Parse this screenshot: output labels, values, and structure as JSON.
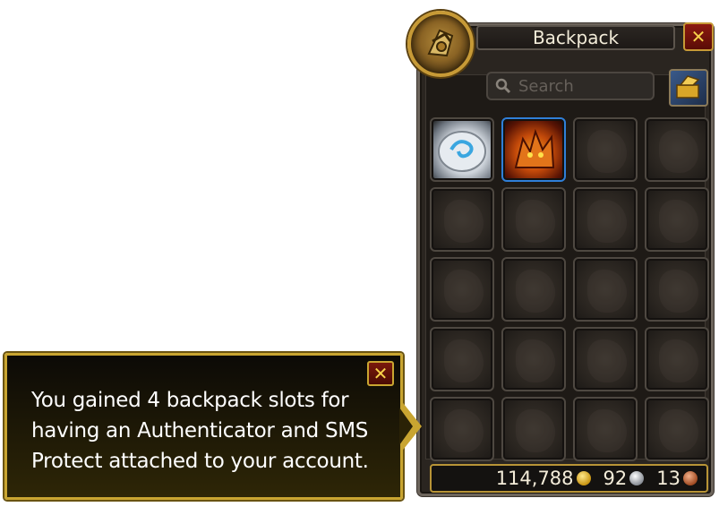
{
  "backpack": {
    "title": "Backpack",
    "search_placeholder": "Search",
    "slots": [
      {
        "item": "hearthstone"
      },
      {
        "item": "fire-pet"
      },
      {
        "item": null
      },
      {
        "item": null
      },
      {
        "item": null
      },
      {
        "item": null
      },
      {
        "item": null
      },
      {
        "item": null
      },
      {
        "item": null
      },
      {
        "item": null
      },
      {
        "item": null
      },
      {
        "item": null
      },
      {
        "item": null
      },
      {
        "item": null
      },
      {
        "item": null
      },
      {
        "item": null
      },
      {
        "item": null
      },
      {
        "item": null
      },
      {
        "item": null
      },
      {
        "item": null
      }
    ],
    "money": {
      "gold": "114,788",
      "silver": "92",
      "copper": "13"
    },
    "icons": {
      "portrait": "backpack-portrait-icon",
      "close": "close-icon",
      "search": "search-icon",
      "sort": "cleanup-bags-icon"
    }
  },
  "tooltip": {
    "line1": "You gained 4 backpack slots for",
    "line2": "having an Authenticator and SMS",
    "line3": "Protect attached to your account."
  },
  "colors": {
    "frame": "#2a2520",
    "gold_border": "#c9a531",
    "title_text": "#f3ecd9",
    "tooltip_text": "#ffffff",
    "pet_slot_border": "#2f7fd8"
  }
}
